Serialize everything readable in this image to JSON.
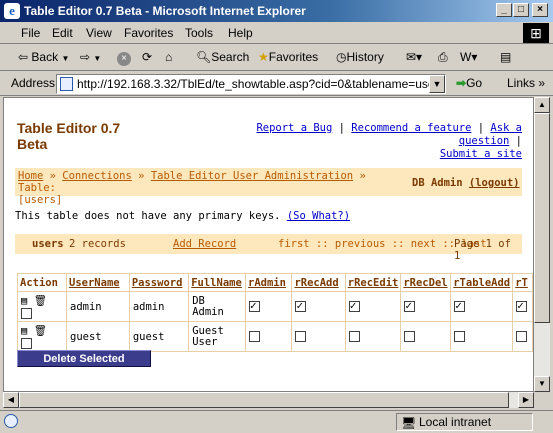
{
  "window": {
    "title": "Table Editor 0.7 Beta - Microsoft Internet Explorer"
  },
  "menu": [
    "File",
    "Edit",
    "View",
    "Favorites",
    "Tools",
    "Help"
  ],
  "toolbar": {
    "back": "Back",
    "search": "Search",
    "favorites": "Favorites",
    "history": "History"
  },
  "address": {
    "label": "Address",
    "url": "http://192.168.3.32/TblEd/te_showtable.asp?cid=0&tablename=users",
    "go": "Go",
    "links": "Links"
  },
  "page": {
    "title_line1": "Table Editor 0.7",
    "title_line2": "Beta",
    "top_links": [
      "Report a Bug",
      "Recommend a feature",
      "Ask a question",
      "Submit a site"
    ],
    "sep": "|",
    "breadcrumb": {
      "home": "Home",
      "connections": "Connections",
      "admin": "Table Editor User Administration",
      "sep": "»",
      "table_label": "Table:",
      "table_name": "[users]"
    },
    "user": {
      "name": "DB Admin",
      "logout": "(logout)"
    },
    "notice": "This table does not have any primary keys.",
    "so_what": "(So What?)",
    "nav": {
      "table": "users",
      "records": "2 records",
      "add": "Add Record",
      "pager": "first :: previous :: next :: last",
      "page": "Page 1 of 1"
    },
    "columns": [
      "Action",
      "UserName",
      "Password",
      "FullName",
      "rAdmin",
      "rRecAdd",
      "rRecEdit",
      "rRecDel",
      "rTableAdd",
      "rT"
    ],
    "rows": [
      {
        "username": "admin",
        "password": "admin",
        "full1": "DB",
        "full2": "Admin",
        "flags": [
          true,
          true,
          true,
          true,
          true,
          true
        ]
      },
      {
        "username": "guest",
        "password": "guest",
        "full1": "Guest",
        "full2": "User",
        "flags": [
          false,
          false,
          false,
          false,
          false,
          false
        ]
      }
    ],
    "delete_button": "Delete Selected"
  },
  "status": {
    "zone": "Local intranet"
  },
  "colors": {
    "accent": "#b85a00",
    "bar": "#fde7bd",
    "button": "#3c3c8c"
  }
}
